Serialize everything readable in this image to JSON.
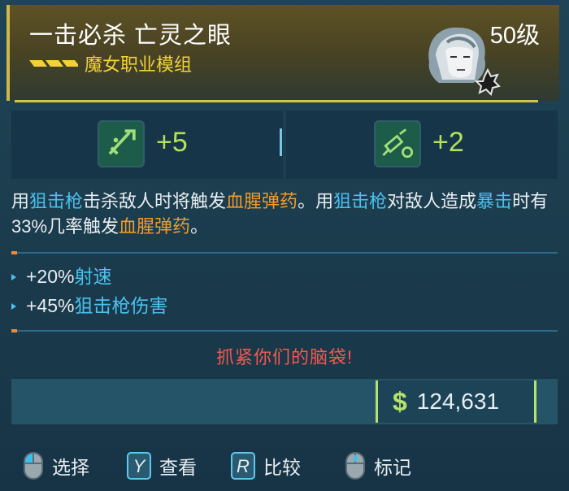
{
  "item": {
    "title": "一击必杀 亡灵之眼",
    "level": "50级",
    "subtitle": "魔女职业模组"
  },
  "stats": [
    {
      "icon": "sniper-rifle-skill-icon",
      "value": "+5"
    },
    {
      "icon": "syringe-skill-icon",
      "value": "+2"
    }
  ],
  "description": {
    "p1": "用",
    "k1": "狙击枪",
    "p2": "击杀敌人时将触发",
    "k2": "血腥弹药",
    "p3": "。用",
    "k3": "狙击枪",
    "p4": "对敌人造成",
    "k4": "暴击",
    "p5": "时有33%几率触发",
    "k5": "血腥弹药",
    "p6": "。"
  },
  "bonuses": [
    {
      "value": "+20%",
      "label": "射速"
    },
    {
      "value": "+45%",
      "label": "狙击枪伤害"
    }
  ],
  "flavor_text": "抓紧你们的脑袋!",
  "price": {
    "symbol": "$",
    "value": "124,631"
  },
  "controls": [
    {
      "key": "mouse-icon",
      "label": "选择"
    },
    {
      "key": "Y",
      "label": "查看"
    },
    {
      "key": "R",
      "label": "比较"
    },
    {
      "key": "mouse-icon",
      "label": "标记"
    }
  ],
  "colors": {
    "rarity_yellow": "#f3d235",
    "keyword_blue": "#4cc0ef",
    "keyword_orange": "#f09b2b",
    "flavor_red": "#f25a4e",
    "stat_green": "#b2e25a"
  }
}
